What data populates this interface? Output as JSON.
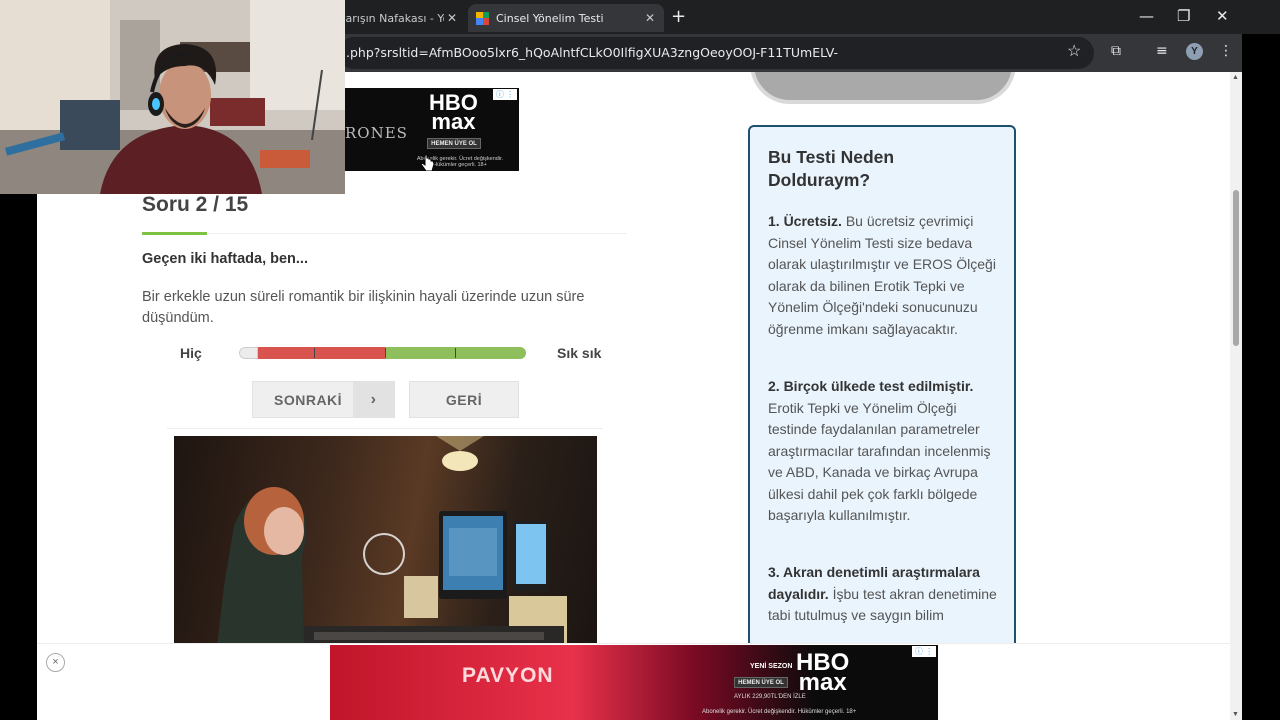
{
  "browser": {
    "tabs": [
      {
        "label": "Barışın Nafakası - Yo"
      },
      {
        "label": "Cinsel Yönelim Testi"
      }
    ],
    "new_tab": "+",
    "address": ".php?srsltid=AfmBOoo5lxr6_hQoAlntfCLkO0IlfigXUA3zngOeoyOOJ-F11TUmELV-",
    "profile_initial": "Y",
    "window_controls": {
      "minimize": "—",
      "restore": "❐",
      "close": "✕"
    }
  },
  "ad_top": {
    "show_text": "RONES",
    "brand_line1": "HBO",
    "brand_line2": "max",
    "cta": "HEMEN ÜYE OL",
    "fine_print": "Abonelik gerekir. Ücret değişkendir. Hükümler geçerli. 18+"
  },
  "quiz": {
    "title": "Soru 2 / 15",
    "progress": 0.1333,
    "lead": "Geçen iki haftada, ben...",
    "question": "Bir erkekle uzun süreli romantik bir ilişkinin hayali üzerinde uzun süre düşündüm.",
    "scale_min": "Hiç",
    "scale_max": "Sık sık",
    "scale_value": 0,
    "next_label": "SONRAKİ",
    "back_label": "GERİ"
  },
  "sidebar": {
    "heading": "Bu Testi Neden Dolduraym?",
    "items": [
      {
        "title": "1. Ücretsiz.",
        "body": "Bu ücretsiz çevrimiçi Cinsel Yönelim Testi size bedava olarak ulaştırılmıştır ve EROS Ölçeği olarak da bilinen Erotik Tepki ve Yönelim Ölçeği'ndeki sonucunuzu öğrenme imkanı sağlayacaktır."
      },
      {
        "title": "2. Birçok ülkede test edilmiştir.",
        "body": "Erotik Tepki ve Yönelim Ölçeği testinde faydalanılan parametreler araştırmacılar tarafından incelenmiş ve ABD, Kanada ve birkaç Avrupa ülkesi dahil pek çok farklı bölgede başarıyla kullanılmıştır."
      },
      {
        "title": "3. Akran denetimli araştırmalara dayalıdır.",
        "body": "İşbu test akran denetimine tabi tutulmuş ve saygın bilim"
      }
    ]
  },
  "ad_bottom": {
    "show_title": "PAVYON",
    "season": "YENİ SEZON",
    "brand_line1": "HBO",
    "brand_line2": "max",
    "cta": "HEMEN ÜYE OL",
    "price": "AYLIK 229,90TL'DEN İZLE",
    "fine_print": "Abonelik gerekir. Ücret değişkendir. Hükümler geçerli. 18+",
    "close": "×"
  }
}
